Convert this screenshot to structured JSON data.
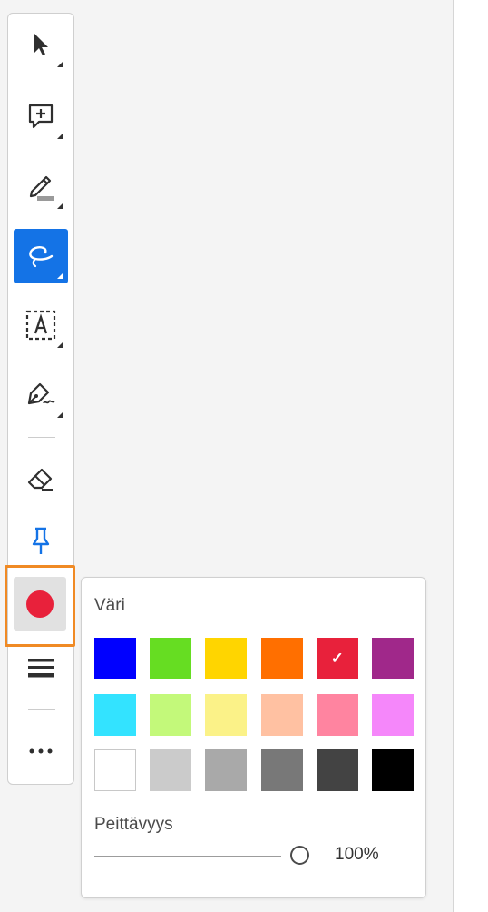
{
  "toolbar": {
    "tools": [
      {
        "name": "select-tool",
        "icon": "arrow-pointer-icon",
        "active": false
      },
      {
        "name": "add-comment-tool",
        "icon": "comment-plus-icon",
        "active": false
      },
      {
        "name": "highlight-tool",
        "icon": "highlighter-icon",
        "active": false
      },
      {
        "name": "freehand-draw-tool",
        "icon": "lasso-loop-icon",
        "active": true
      },
      {
        "name": "text-box-tool",
        "icon": "text-box-icon",
        "active": false
      },
      {
        "name": "signature-tool",
        "icon": "pen-sign-icon",
        "active": false
      },
      {
        "name": "eraser-tool",
        "icon": "eraser-icon",
        "active": false
      },
      {
        "name": "pin-tool",
        "icon": "pin-icon",
        "active": false
      },
      {
        "name": "color-tool",
        "icon": "color-dot-icon",
        "active": false
      },
      {
        "name": "line-width-tool",
        "icon": "line-width-icon",
        "active": false
      },
      {
        "name": "more-tool",
        "icon": "ellipsis-icon",
        "active": false
      }
    ],
    "selected_color": "#e8213b"
  },
  "color_popover": {
    "title": "Väri",
    "swatches": [
      [
        "#0000ff",
        "#66dd22",
        "#ffd500",
        "#ff6f00",
        "#e8213b",
        "#a0288a"
      ],
      [
        "#33e3ff",
        "#c3f97a",
        "#fbf288",
        "#ffc1a2",
        "#ff84a0",
        "#f587fa"
      ],
      [
        "#ffffff",
        "#cbcbcb",
        "#a9a9a9",
        "#787878",
        "#434343",
        "#000000"
      ]
    ],
    "selected_swatch": "#e8213b",
    "checkmark": "✓",
    "opacity_label": "Peittävyys",
    "opacity_value": "100%",
    "opacity_fraction": 1.0
  }
}
